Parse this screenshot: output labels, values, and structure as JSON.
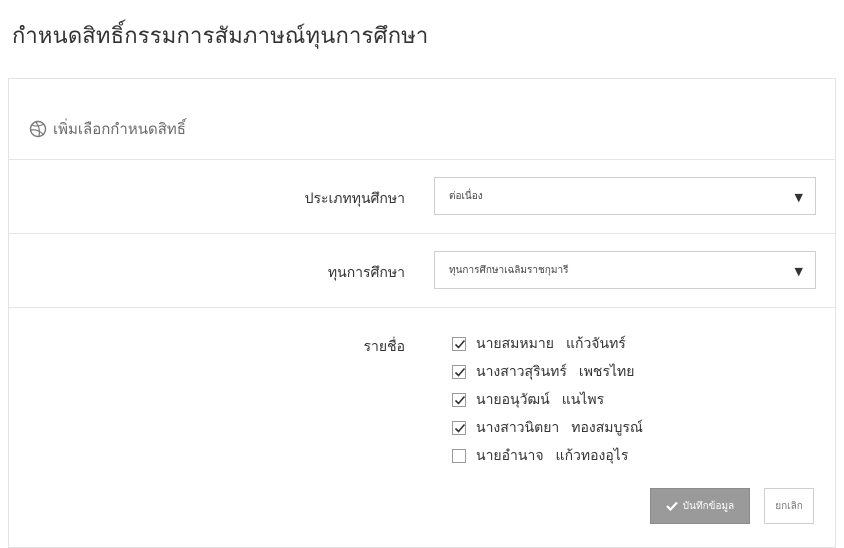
{
  "page_title": "กำหนดสิทธิ์กรรมการสัมภาษณ์ทุนการศึกษา",
  "panel": {
    "heading": "เพิ่มเลือกกำหนดสิทธิ์",
    "heading_icon": "dribbble-ball-icon"
  },
  "form": {
    "scholarship_type": {
      "label": "ประเภททุนศึกษา",
      "value": "ต่อเนื่อง"
    },
    "scholarship": {
      "label": "ทุนการศึกษา",
      "value": "ทุนการศึกษาเฉลิมราชกุมารี"
    },
    "names": {
      "label": "รายชื่อ",
      "items": [
        {
          "first": "นายสมหมาย",
          "last": "แก้วจันทร์",
          "checked": true
        },
        {
          "first": "นางสาวสุรินทร์",
          "last": "เพชรไทย",
          "checked": true
        },
        {
          "first": "นายอนุวัฒน์",
          "last": "แนไพร",
          "checked": true
        },
        {
          "first": "นางสาวนิตยา",
          "last": "ทองสมบูรณ์",
          "checked": true
        },
        {
          "first": "นายอำนาจ",
          "last": "แก้วทองอุไร",
          "checked": false
        }
      ]
    }
  },
  "buttons": {
    "save": "บันทึกข้อมูล",
    "cancel": "ยกเลิก"
  },
  "colors": {
    "save_bg": "#9a9a9a",
    "border": "#e3e3e3"
  }
}
